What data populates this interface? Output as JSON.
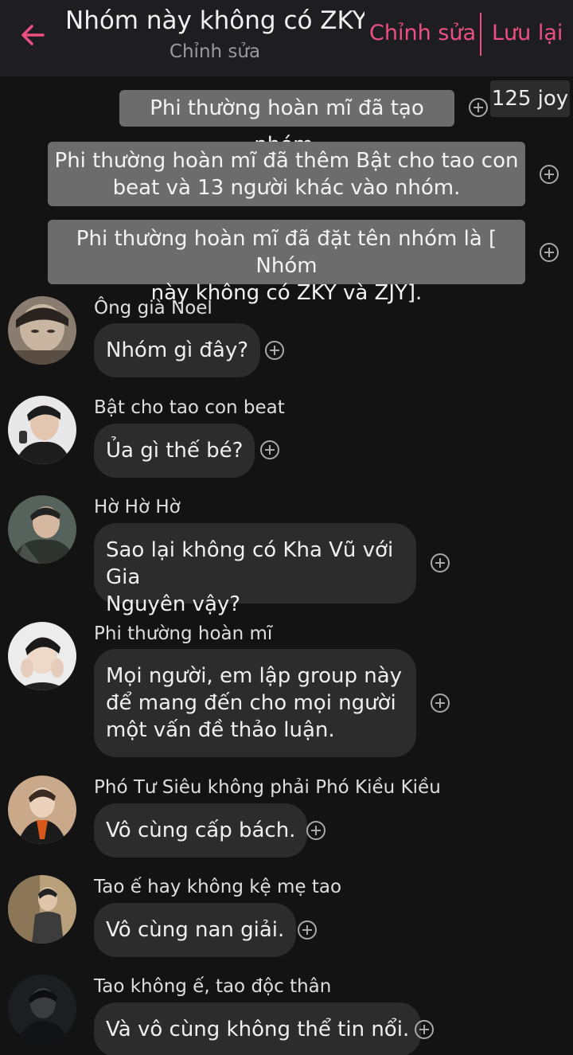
{
  "header": {
    "title": "Nhóm này không có ZKY...",
    "subtitle": "Chỉnh sửa",
    "edit_label": "Chỉnh sửa",
    "save_label": "Lưu lại"
  },
  "badge": "125 joy",
  "system_messages": [
    "Phi thường hoàn mĩ đã tạo nhóm.",
    "Phi thường hoàn mĩ đã thêm Bật cho tao con\nbeat và 13 người khác vào nhóm.",
    "Phi thường hoàn mĩ đã đặt tên nhóm là [ Nhóm\nnày không có ZKY và ZJY]."
  ],
  "messages": [
    {
      "sender": "Ông già Noel",
      "text": "Nhóm gì đây?"
    },
    {
      "sender": "Bật cho tao con beat",
      "text": "Ủa gì thế bé?"
    },
    {
      "sender": "Hờ Hờ Hờ",
      "text": "Sao lại không có Kha Vũ với Gia\nNguyên vậy?"
    },
    {
      "sender": "Phi thường hoàn mĩ",
      "text": "Mọi người, em lập group này\nđể mang đến cho mọi người\nmột vấn đề thảo luận."
    },
    {
      "sender": "Phó Tư Siêu không phải Phó Kiều Kiều",
      "text": "Vô cùng cấp bách."
    },
    {
      "sender": "Tao ế hay không kệ mẹ tao",
      "text": "Vô cùng nan giải."
    },
    {
      "sender": "Tao không ế, tao độc thân",
      "text": "Và vô cùng không thể tin nổi."
    }
  ],
  "colors": {
    "accent": "#ee4f83",
    "background": "#131314",
    "header": "#1e1e20",
    "bubble": "#2c2c2c",
    "system_bubble": "#6c6c6c"
  }
}
